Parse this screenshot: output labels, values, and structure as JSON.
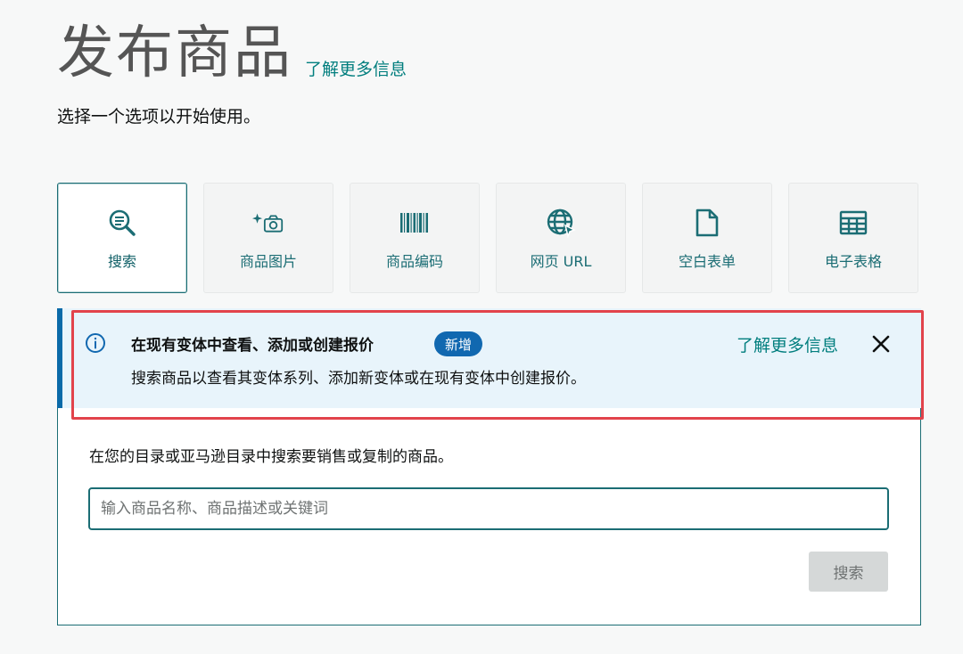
{
  "header": {
    "title": "发布商品",
    "learn_more": "了解更多信息",
    "subtitle": "选择一个选项以开始使用。"
  },
  "options": [
    {
      "label": "搜索",
      "icon": "search-icon",
      "selected": true
    },
    {
      "label": "商品图片",
      "icon": "camera-sparkle-icon",
      "selected": false
    },
    {
      "label": "商品编码",
      "icon": "barcode-icon",
      "selected": false
    },
    {
      "label": "网页 URL",
      "icon": "globe-icon",
      "selected": false
    },
    {
      "label": "空白表单",
      "icon": "document-icon",
      "selected": false
    },
    {
      "label": "电子表格",
      "icon": "spreadsheet-icon",
      "selected": false
    }
  ],
  "banner": {
    "title": "在现有变体中查看、添加或创建报价",
    "badge": "新增",
    "text": "搜索商品以查看其变体系列、添加新变体或在现有变体中创建报价。",
    "learn_more": "了解更多信息",
    "colors": {
      "background": "#e8f4fb",
      "accent": "#0a6aa8",
      "highlight": "#e2434b"
    }
  },
  "search": {
    "description": "在您的目录或亚马逊目录中搜索要销售或复制的商品。",
    "placeholder": "输入商品名称、商品描述或关键词",
    "value": "",
    "button_label": "搜索"
  },
  "colors": {
    "teal": "#1b6d74",
    "link": "#017e7e",
    "disabled": "#d5d8d8"
  }
}
